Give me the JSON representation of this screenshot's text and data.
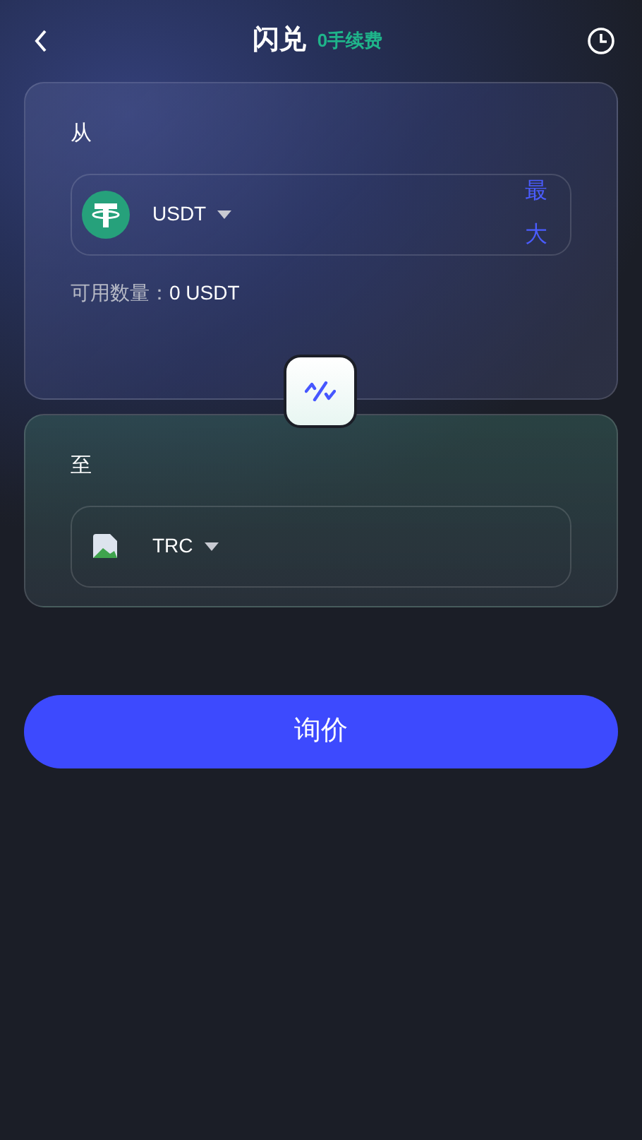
{
  "header": {
    "title": "闪兑",
    "fee_note": "0手续费"
  },
  "from": {
    "label": "从",
    "token": "USDT",
    "kind": "tether",
    "max": "最大",
    "available_label": "可用数量：",
    "available_value": "0 USDT"
  },
  "to": {
    "label": "至",
    "token": "TRC",
    "kind": "broken-image"
  },
  "submit": "询价"
}
